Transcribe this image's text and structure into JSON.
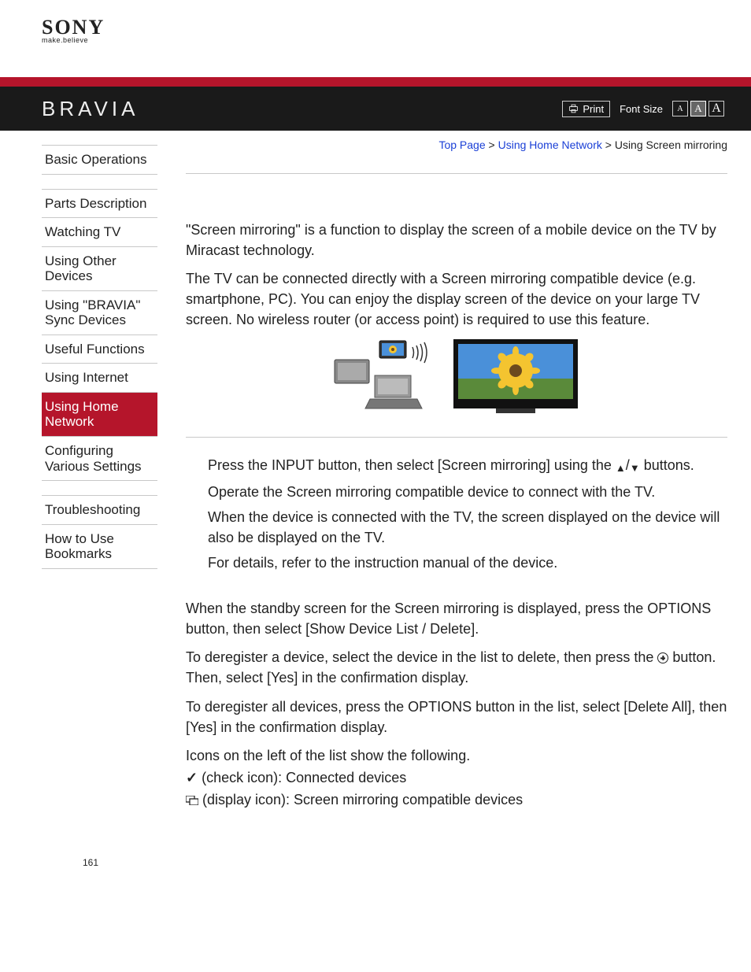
{
  "header": {
    "brand": "SONY",
    "tagline": "make.believe",
    "product": "BRAVIA",
    "print_label": "Print",
    "font_size_label": "Font Size",
    "size_small": "A",
    "size_med": "A",
    "size_large": "A"
  },
  "breadcrumb": {
    "top": "Top Page",
    "section": "Using Home Network",
    "current": "Using Screen mirroring",
    "sep": ">"
  },
  "sidebar": {
    "group1": [
      "Basic Operations"
    ],
    "group2": [
      "Parts Description",
      "Watching TV",
      "Using Other Devices",
      "Using \"BRAVIA\" Sync Devices",
      "Useful Functions",
      "Using Internet",
      "Using Home Network",
      "Configuring Various Settings"
    ],
    "group3": [
      "Troubleshooting",
      "How to Use Bookmarks"
    ],
    "active": "Using Home Network"
  },
  "content": {
    "p1": "\"Screen mirroring\" is a function to display the screen of a mobile device on the TV by Miracast technology.",
    "p2": "The TV can be connected directly with a Screen mirroring compatible device (e.g. smartphone, PC). You can enjoy the display screen of the device on your large TV screen. No wireless router (or access point) is required to use this feature.",
    "step1_a": "Press the INPUT button, then select [Screen mirroring] using the ",
    "step1_b": "/",
    "step1_c": " buttons.",
    "step2": "Operate the Screen mirroring compatible device to connect with the TV.",
    "step2b": "When the device is connected with the TV, the screen displayed on the device will also be displayed on the TV.",
    "step2c": "For details, refer to the instruction manual of the device.",
    "p3": "When the standby screen for the Screen mirroring is displayed, press the OPTIONS button, then select [Show Device List / Delete].",
    "p4_a": "To deregister a device, select the device in the list to delete, then press the ",
    "p4_b": " button. Then, select [Yes] in the confirmation display.",
    "p5": "To deregister all devices, press the OPTIONS button in the list, select [Delete All], then [Yes] in the confirmation display.",
    "p6": "Icons on the left of the list show the following.",
    "icon_check": " (check icon): Connected devices",
    "icon_display": " (display icon): Screen mirroring compatible devices"
  },
  "page_number": "161"
}
